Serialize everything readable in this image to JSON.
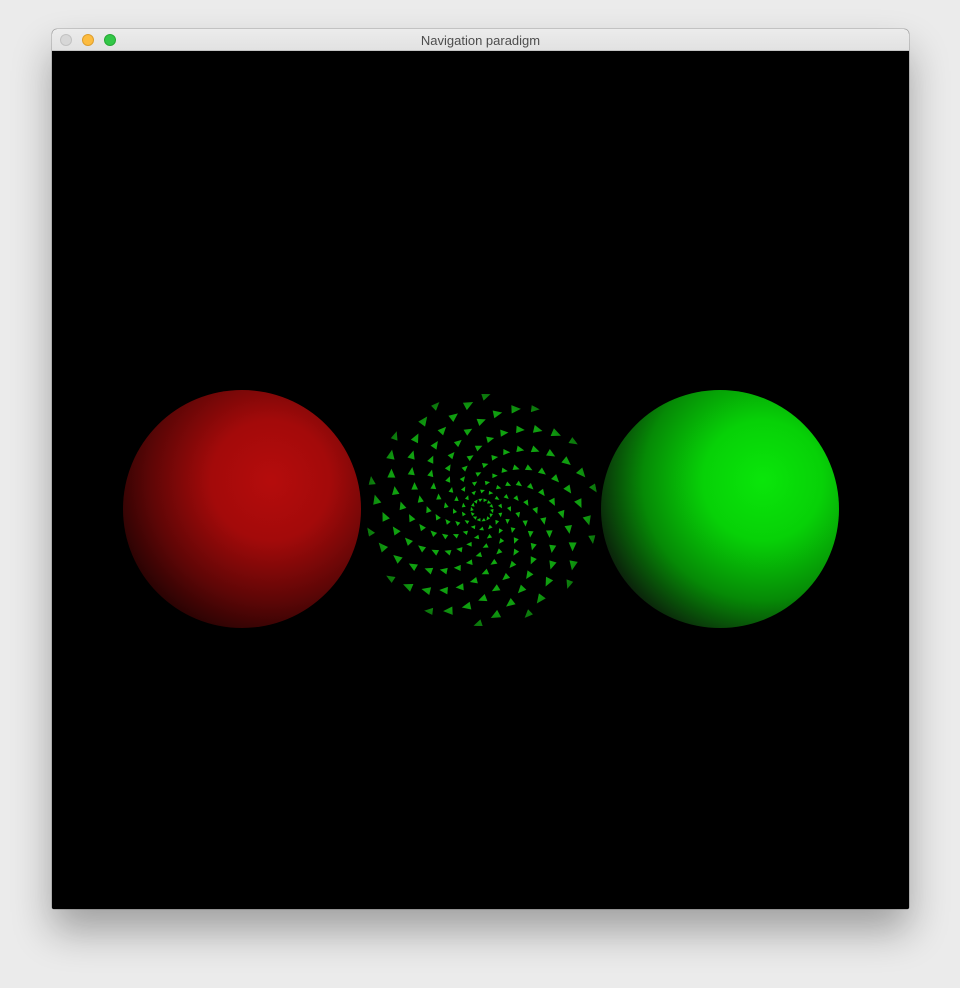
{
  "window": {
    "title": "Navigation paradigm",
    "controls": {
      "close_color": "#d7d7d7",
      "minimize_color": "#fdbc40",
      "zoom_color": "#33c748"
    }
  },
  "scene": {
    "background_color": "#000000",
    "spheres": [
      {
        "name": "red-sphere",
        "color": "#c00808",
        "material": "shaded"
      },
      {
        "name": "textured-sphere",
        "color": "#12b812",
        "material": "spiral-texture"
      },
      {
        "name": "green-sphere",
        "color": "#0ae60a",
        "material": "shaded"
      }
    ]
  }
}
